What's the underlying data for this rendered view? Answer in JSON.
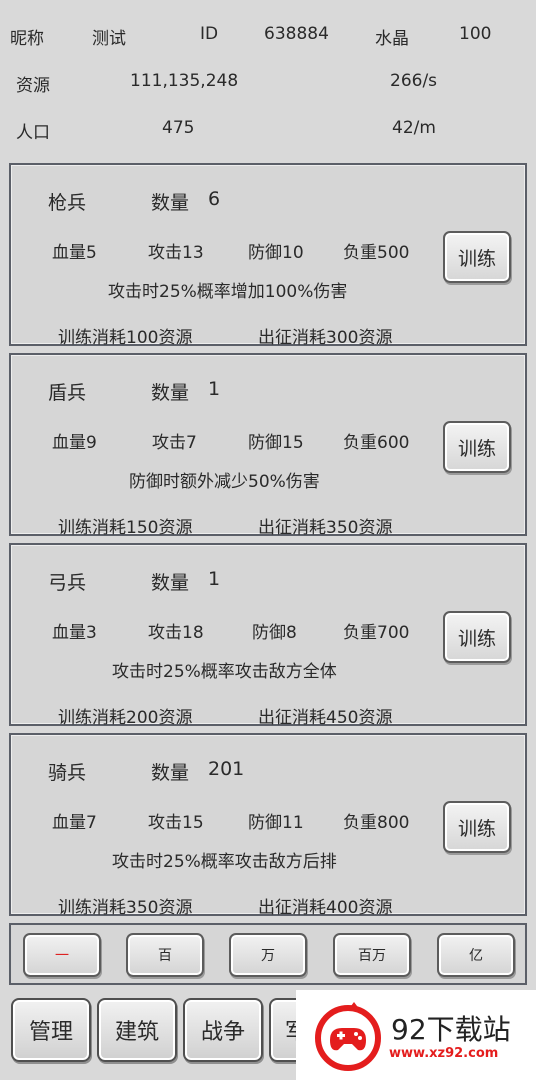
{
  "header": {
    "nickname_label": "昵称",
    "nickname": "测试",
    "id_label": "ID",
    "id": "638884",
    "crystal_label": "水晶",
    "crystal": "100",
    "resource_label": "资源",
    "resource": "111,135,248",
    "resource_rate": "266/s",
    "population_label": "人口",
    "population": "475",
    "population_rate": "42/m"
  },
  "units": [
    {
      "name": "枪兵",
      "count_label": "数量",
      "count": "6",
      "hp": "血量5",
      "atk": "攻击13",
      "def": "防御10",
      "load": "负重500",
      "desc": "攻击时25%概率增加100%伤害",
      "train_cost": "训练消耗100资源",
      "march_cost": "出征消耗300资源",
      "train_btn": "训练"
    },
    {
      "name": "盾兵",
      "count_label": "数量",
      "count": "1",
      "hp": "血量9",
      "atk": "攻击7",
      "def": "防御15",
      "load": "负重600",
      "desc": "防御时额外减少50%伤害",
      "train_cost": "训练消耗150资源",
      "march_cost": "出征消耗350资源",
      "train_btn": "训练"
    },
    {
      "name": "弓兵",
      "count_label": "数量",
      "count": "1",
      "hp": "血量3",
      "atk": "攻击18",
      "def": "防御8",
      "load": "负重700",
      "desc": "攻击时25%概率攻击敌方全体",
      "train_cost": "训练消耗200资源",
      "march_cost": "出征消耗450资源",
      "train_btn": "训练"
    },
    {
      "name": "骑兵",
      "count_label": "数量",
      "count": "201",
      "hp": "血量7",
      "atk": "攻击15",
      "def": "防御11",
      "load": "负重800",
      "desc": "攻击时25%概率攻击敌方后排",
      "train_cost": "训练消耗350资源",
      "march_cost": "出征消耗400资源",
      "train_btn": "训练"
    }
  ],
  "multipliers": [
    "一",
    "百",
    "万",
    "百万",
    "亿"
  ],
  "nav": [
    "管理",
    "建筑",
    "战争",
    "军"
  ],
  "watermark": {
    "title": "92下载站",
    "url": "www.xz92.com"
  },
  "colors": {
    "active_multiplier": "#dd2222",
    "watermark_red": "#e41d1d"
  }
}
